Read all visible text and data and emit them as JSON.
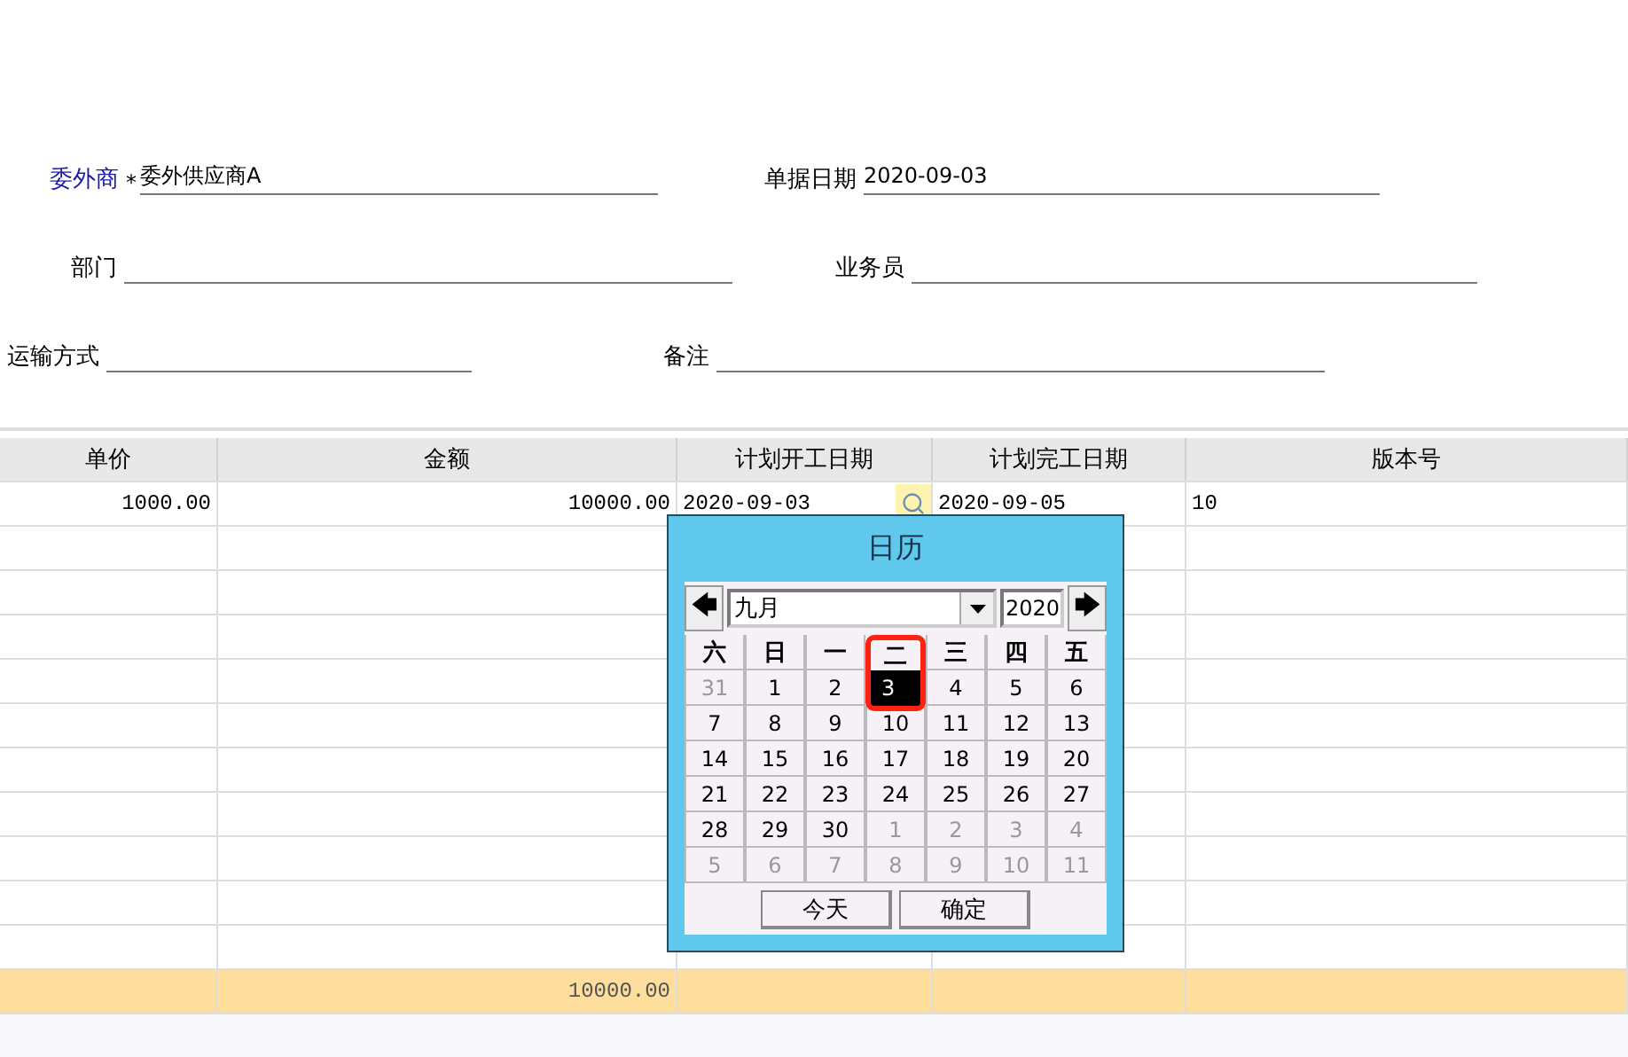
{
  "form": {
    "rows": [
      {
        "fields": [
          {
            "label": "委外商",
            "required": true,
            "required_mark": "*",
            "value": "委外供应商A"
          },
          {
            "label": "单据日期",
            "required": false,
            "value": "2020-09-03"
          }
        ]
      },
      {
        "fields": [
          {
            "label": "部门",
            "required": false
          },
          {
            "label": "业务员",
            "required": false
          }
        ]
      },
      {
        "fields": [
          {
            "label": "运输方式",
            "required": false
          },
          {
            "label": "备注",
            "required": false
          }
        ]
      }
    ]
  },
  "table": {
    "columns": [
      "单价",
      "金额",
      "计划开工日期",
      "计划完工日期",
      "版本号"
    ],
    "rows": [
      {
        "cells": [
          "1000.00",
          "10000.00",
          "2020-09-03",
          "2020-09-05",
          "10"
        ]
      }
    ],
    "total": {
      "amount": "10000.00"
    }
  },
  "calendar": {
    "title": "日历",
    "month": "九月",
    "year": "2020",
    "prev": "🡄",
    "next": "🡆",
    "weekdays": [
      {
        "label": "六",
        "highlighted": false
      },
      {
        "label": "日",
        "highlighted": false
      },
      {
        "label": "一",
        "highlighted": false
      },
      {
        "label": "二",
        "highlighted": true
      },
      {
        "label": "三",
        "highlighted": false
      },
      {
        "label": "四",
        "highlighted": false
      },
      {
        "label": "五",
        "highlighted": false
      }
    ],
    "days": [
      {
        "day": "31",
        "in_month": false,
        "selected": false
      },
      {
        "day": "1",
        "in_month": true,
        "selected": false
      },
      {
        "day": "2",
        "in_month": true,
        "selected": false
      },
      {
        "day": "3",
        "in_month": true,
        "selected": true
      },
      {
        "day": "4",
        "in_month": true,
        "selected": false
      },
      {
        "day": "5",
        "in_month": true,
        "selected": false
      },
      {
        "day": "6",
        "in_month": true,
        "selected": false
      },
      {
        "day": "7",
        "in_month": true,
        "selected": false
      },
      {
        "day": "8",
        "in_month": true,
        "selected": false
      },
      {
        "day": "9",
        "in_month": true,
        "selected": false
      },
      {
        "day": "10",
        "in_month": true,
        "selected": false
      },
      {
        "day": "11",
        "in_month": true,
        "selected": false
      },
      {
        "day": "12",
        "in_month": true,
        "selected": false
      },
      {
        "day": "13",
        "in_month": true,
        "selected": false
      },
      {
        "day": "14",
        "in_month": true,
        "selected": false
      },
      {
        "day": "15",
        "in_month": true,
        "selected": false
      },
      {
        "day": "16",
        "in_month": true,
        "selected": false
      },
      {
        "day": "17",
        "in_month": true,
        "selected": false
      },
      {
        "day": "18",
        "in_month": true,
        "selected": false
      },
      {
        "day": "19",
        "in_month": true,
        "selected": false
      },
      {
        "day": "20",
        "in_month": true,
        "selected": false
      },
      {
        "day": "21",
        "in_month": true,
        "selected": false
      },
      {
        "day": "22",
        "in_month": true,
        "selected": false
      },
      {
        "day": "23",
        "in_month": true,
        "selected": false
      },
      {
        "day": "24",
        "in_month": true,
        "selected": false
      },
      {
        "day": "25",
        "in_month": true,
        "selected": false
      },
      {
        "day": "26",
        "in_month": true,
        "selected": false
      },
      {
        "day": "27",
        "in_month": true,
        "selected": false
      },
      {
        "day": "28",
        "in_month": true,
        "selected": false
      },
      {
        "day": "29",
        "in_month": true,
        "selected": false
      },
      {
        "day": "30",
        "in_month": true,
        "selected": false
      },
      {
        "day": "1",
        "in_month": false,
        "selected": false
      },
      {
        "day": "2",
        "in_month": false,
        "selected": false
      },
      {
        "day": "3",
        "in_month": false,
        "selected": false
      },
      {
        "day": "4",
        "in_month": false,
        "selected": false
      },
      {
        "day": "5",
        "in_month": false,
        "selected": false
      },
      {
        "day": "6",
        "in_month": false,
        "selected": false
      },
      {
        "day": "7",
        "in_month": false,
        "selected": false
      },
      {
        "day": "8",
        "in_month": false,
        "selected": false
      },
      {
        "day": "9",
        "in_month": false,
        "selected": false
      },
      {
        "day": "10",
        "in_month": false,
        "selected": false
      },
      {
        "day": "11",
        "in_month": false,
        "selected": false
      }
    ],
    "buttons": [
      "今天",
      "确定"
    ]
  }
}
